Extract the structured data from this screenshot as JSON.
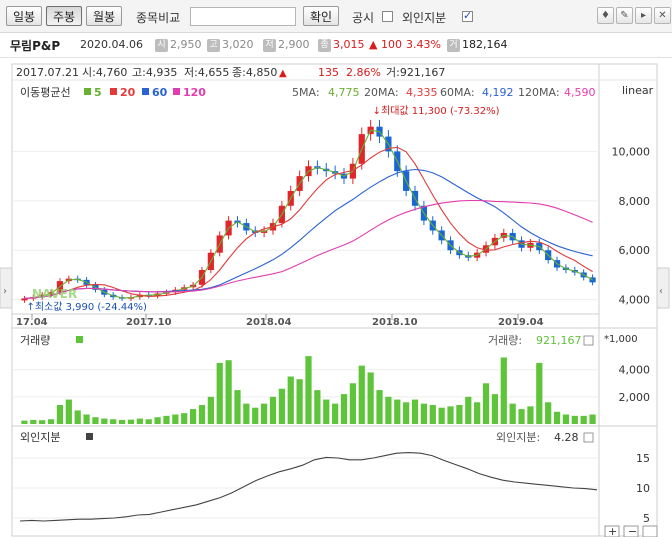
{
  "toolbar": {
    "daily": "일봉",
    "weekly": "주봉",
    "monthly": "월봉",
    "compare_label": "종목비교",
    "compare_value": "",
    "confirm": "확인",
    "disclosure": "공시",
    "foreign": "외인지분"
  },
  "stock": {
    "name": "무림P&P",
    "date": "2020.04.06",
    "open_icon": "시",
    "open": "2,950",
    "high_icon": "고",
    "high": "3,020",
    "low_icon": "저",
    "low": "2,900",
    "close_icon": "종",
    "close": "3,015",
    "change": "▲ 100",
    "pct": "3.43%",
    "vol_icon": "거",
    "volume": "182,164"
  },
  "candle_info": {
    "date": "2017.07.21",
    "open": "시:4,760",
    "high": "고:4,935",
    "low": "저:4,655",
    "close": "종:4,850",
    "change": "▲",
    "change_val": "135",
    "pct": "2.86%",
    "volume": "거:921,167",
    "scale": "linear"
  },
  "ma_legend": {
    "title": "이동평균선",
    "p5": "5",
    "p20": "20",
    "p60": "60",
    "p120": "120",
    "ma5_label": "5MA:",
    "ma5_val": "4,775",
    "ma20_label": "20MA:",
    "ma20_val": "4,335",
    "ma60_label": "60MA:",
    "ma60_val": "4,192",
    "ma120_label": "120MA:",
    "ma120_val": "4,590"
  },
  "annotations": {
    "max": "최대값 11,300 (-73.32%)",
    "min": "최소값 3,990 (-24.44%)",
    "watermark": "NAVER"
  },
  "volume_panel": {
    "title": "거래량",
    "label": "거래량:",
    "value": "921,167",
    "unit": "*1,000"
  },
  "foreign_panel": {
    "title": "외인지분",
    "label": "외인지분:",
    "value": "4.28"
  },
  "colors": {
    "up": "#e0262b",
    "down": "#1a67d4",
    "ma5": "#68b030",
    "ma20": "#e23a3a",
    "ma60": "#2a63d2",
    "ma120": "#e23cae",
    "volume": "#5ec43a",
    "foreign": "#444444"
  },
  "chart_data": {
    "type": "candlestick",
    "x_ticks": [
      "17.04",
      "2017.10",
      "2018.04",
      "2018.10",
      "2019.04"
    ],
    "y_ticks": [
      4000,
      6000,
      8000,
      10000
    ],
    "ylim": [
      3500,
      12000
    ],
    "close_series": [
      4050,
      4100,
      4200,
      4300,
      4750,
      4850,
      4800,
      4600,
      4400,
      4200,
      4100,
      4050,
      4100,
      4200,
      4150,
      4250,
      4300,
      4400,
      4500,
      4600,
      5200,
      5900,
      6600,
      7200,
      7100,
      6800,
      6700,
      6800,
      7100,
      7800,
      8400,
      9000,
      9400,
      9300,
      9200,
      9100,
      8900,
      9500,
      10700,
      11000,
      10600,
      10000,
      9200,
      8400,
      7800,
      7200,
      6800,
      6400,
      6000,
      5800,
      5700,
      5900,
      6200,
      6500,
      6700,
      6400,
      6100,
      6300,
      6000,
      5600,
      5300,
      5200,
      5100,
      4900,
      4700
    ],
    "vol_ticks": [
      2000,
      4000
    ],
    "volume": [
      250,
      300,
      280,
      350,
      1400,
      1800,
      1000,
      700,
      500,
      400,
      350,
      300,
      320,
      400,
      350,
      500,
      600,
      700,
      800,
      1100,
      1400,
      2000,
      4500,
      4700,
      2500,
      1500,
      1200,
      1500,
      2000,
      2600,
      3500,
      3300,
      5000,
      2500,
      1800,
      1500,
      2200,
      3000,
      4300,
      3800,
      2500,
      2000,
      1800,
      1600,
      1800,
      1500,
      1400,
      1200,
      1300,
      1400,
      2000,
      1600,
      3000,
      2200,
      4900,
      1500,
      1100,
      1300,
      4500,
      1600,
      900,
      700,
      600,
      600,
      700
    ],
    "foreign_ticks": [
      5,
      10,
      15
    ],
    "foreign": [
      4.5,
      4.6,
      4.5,
      4.6,
      4.7,
      4.8,
      4.8,
      4.9,
      5.0,
      5.2,
      5.5,
      5.6,
      6.0,
      6.4,
      6.8,
      7.2,
      7.8,
      8.4,
      9.2,
      10.2,
      11.2,
      12.0,
      12.7,
      13.2,
      13.8,
      14.7,
      15.1,
      15.0,
      14.7,
      14.7,
      15.0,
      15.4,
      15.8,
      15.9,
      15.8,
      15.4,
      14.6,
      13.9,
      13.2,
      12.4,
      11.8,
      11.3,
      11.0,
      10.8,
      10.6,
      10.4,
      10.2,
      10.0,
      9.9,
      9.7
    ]
  }
}
